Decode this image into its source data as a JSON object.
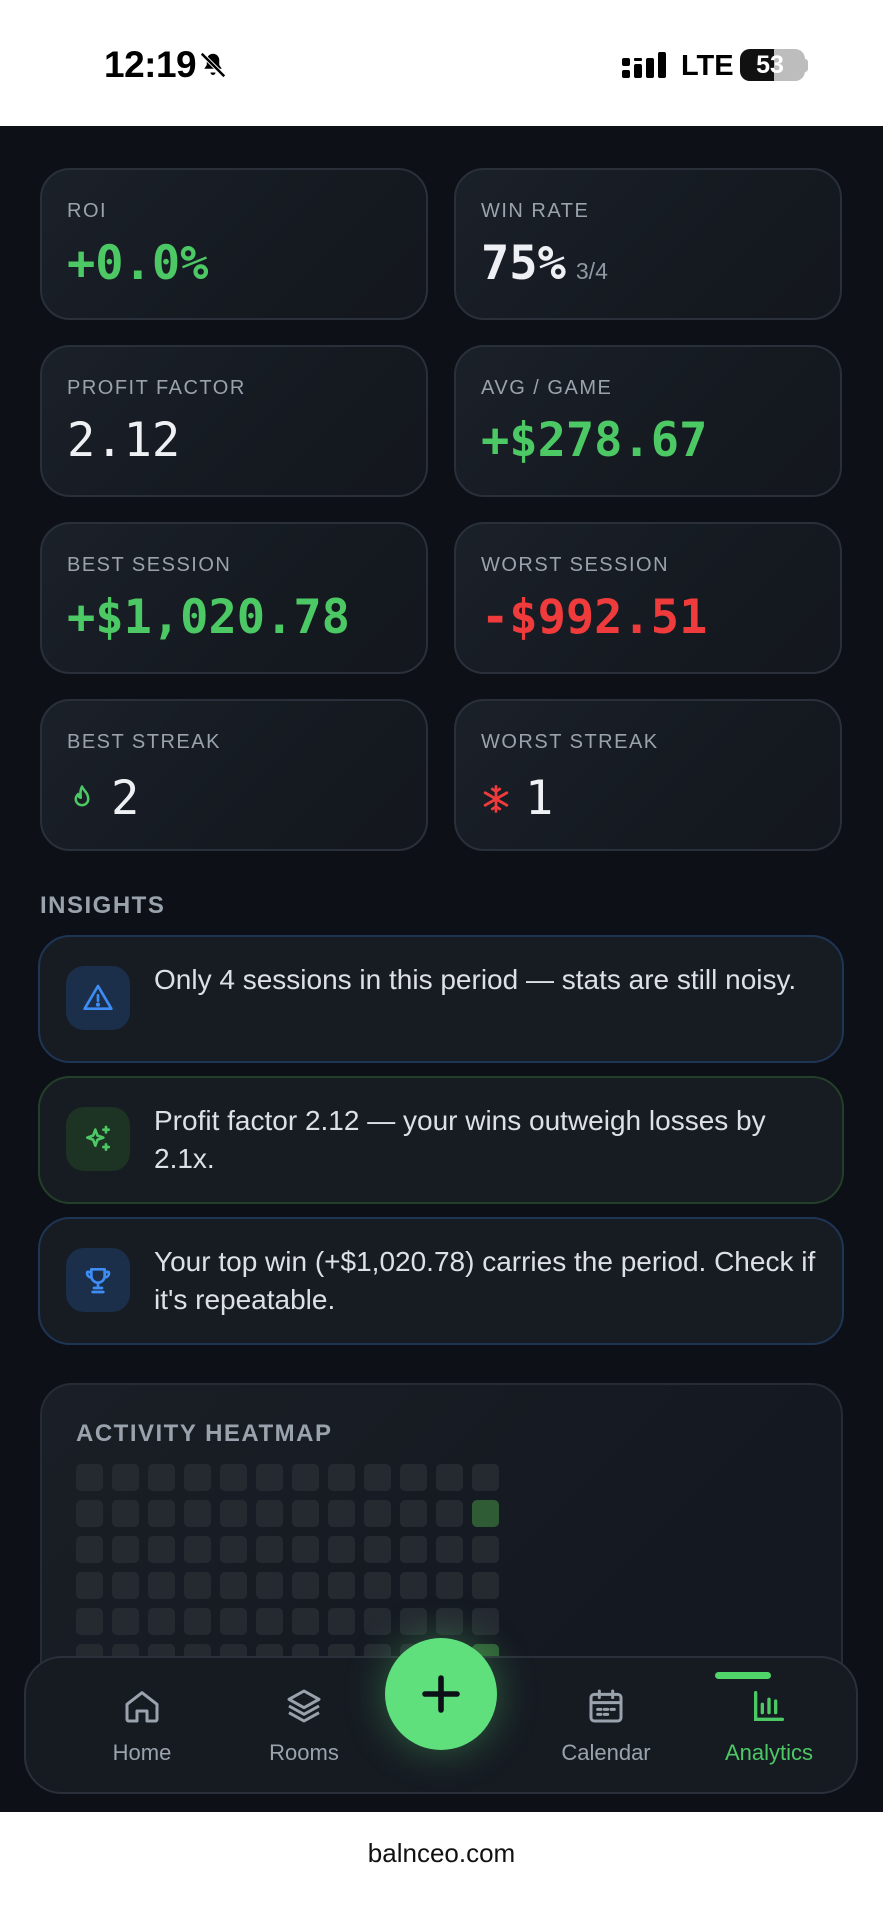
{
  "status_bar": {
    "time": "12:19",
    "network": "LTE",
    "battery": "53",
    "battery_level": 0.53
  },
  "stats": [
    {
      "label": "ROI",
      "value": "+0.0%",
      "tone": "green"
    },
    {
      "label": "WIN RATE",
      "value": "75%",
      "sub": "3/4",
      "tone": "white"
    },
    {
      "label": "PROFIT FACTOR",
      "value": "2.12",
      "tone": "white"
    },
    {
      "label": "AVG / GAME",
      "value": "+$278.67",
      "tone": "green"
    },
    {
      "label": "BEST SESSION",
      "value": "+$1,020.78",
      "tone": "green"
    },
    {
      "label": "WORST SESSION",
      "value": "-$992.51",
      "tone": "red"
    },
    {
      "label": "BEST STREAK",
      "value": "2",
      "icon": "flame-icon"
    },
    {
      "label": "WORST STREAK",
      "value": "1",
      "icon": "snowflake-icon"
    }
  ],
  "insights": {
    "title": "INSIGHTS",
    "items": [
      {
        "icon": "warning-icon",
        "text": "Only 4 sessions in this period — stats are still noisy."
      },
      {
        "icon": "sparkle-icon",
        "text": "Profit factor 2.12 — your wins outweigh losses by 2.1x."
      },
      {
        "icon": "trophy-icon",
        "text": "Your top win (+$1,020.78) carries the period. Check if it's repeatable."
      }
    ]
  },
  "heatmap": {
    "title": "ACTIVITY HEATMAP",
    "active_cells": [
      [
        1,
        11
      ],
      [
        5,
        11
      ]
    ]
  },
  "nav": {
    "items": [
      {
        "label": "Home",
        "icon": "home-icon"
      },
      {
        "label": "Rooms",
        "icon": "layers-icon"
      },
      {
        "label": "Calendar",
        "icon": "calendar-icon"
      },
      {
        "label": "Analytics",
        "icon": "bar-chart-icon",
        "active": true
      }
    ],
    "add_icon": "plus-icon"
  },
  "browser": {
    "url": "balnceo.com"
  },
  "colors": {
    "background": "#0d1117",
    "card": "#161b22",
    "positive": "#4cc865",
    "negative": "#ef3b3b",
    "accent": "#5fe07c",
    "info": "#1e3556"
  }
}
